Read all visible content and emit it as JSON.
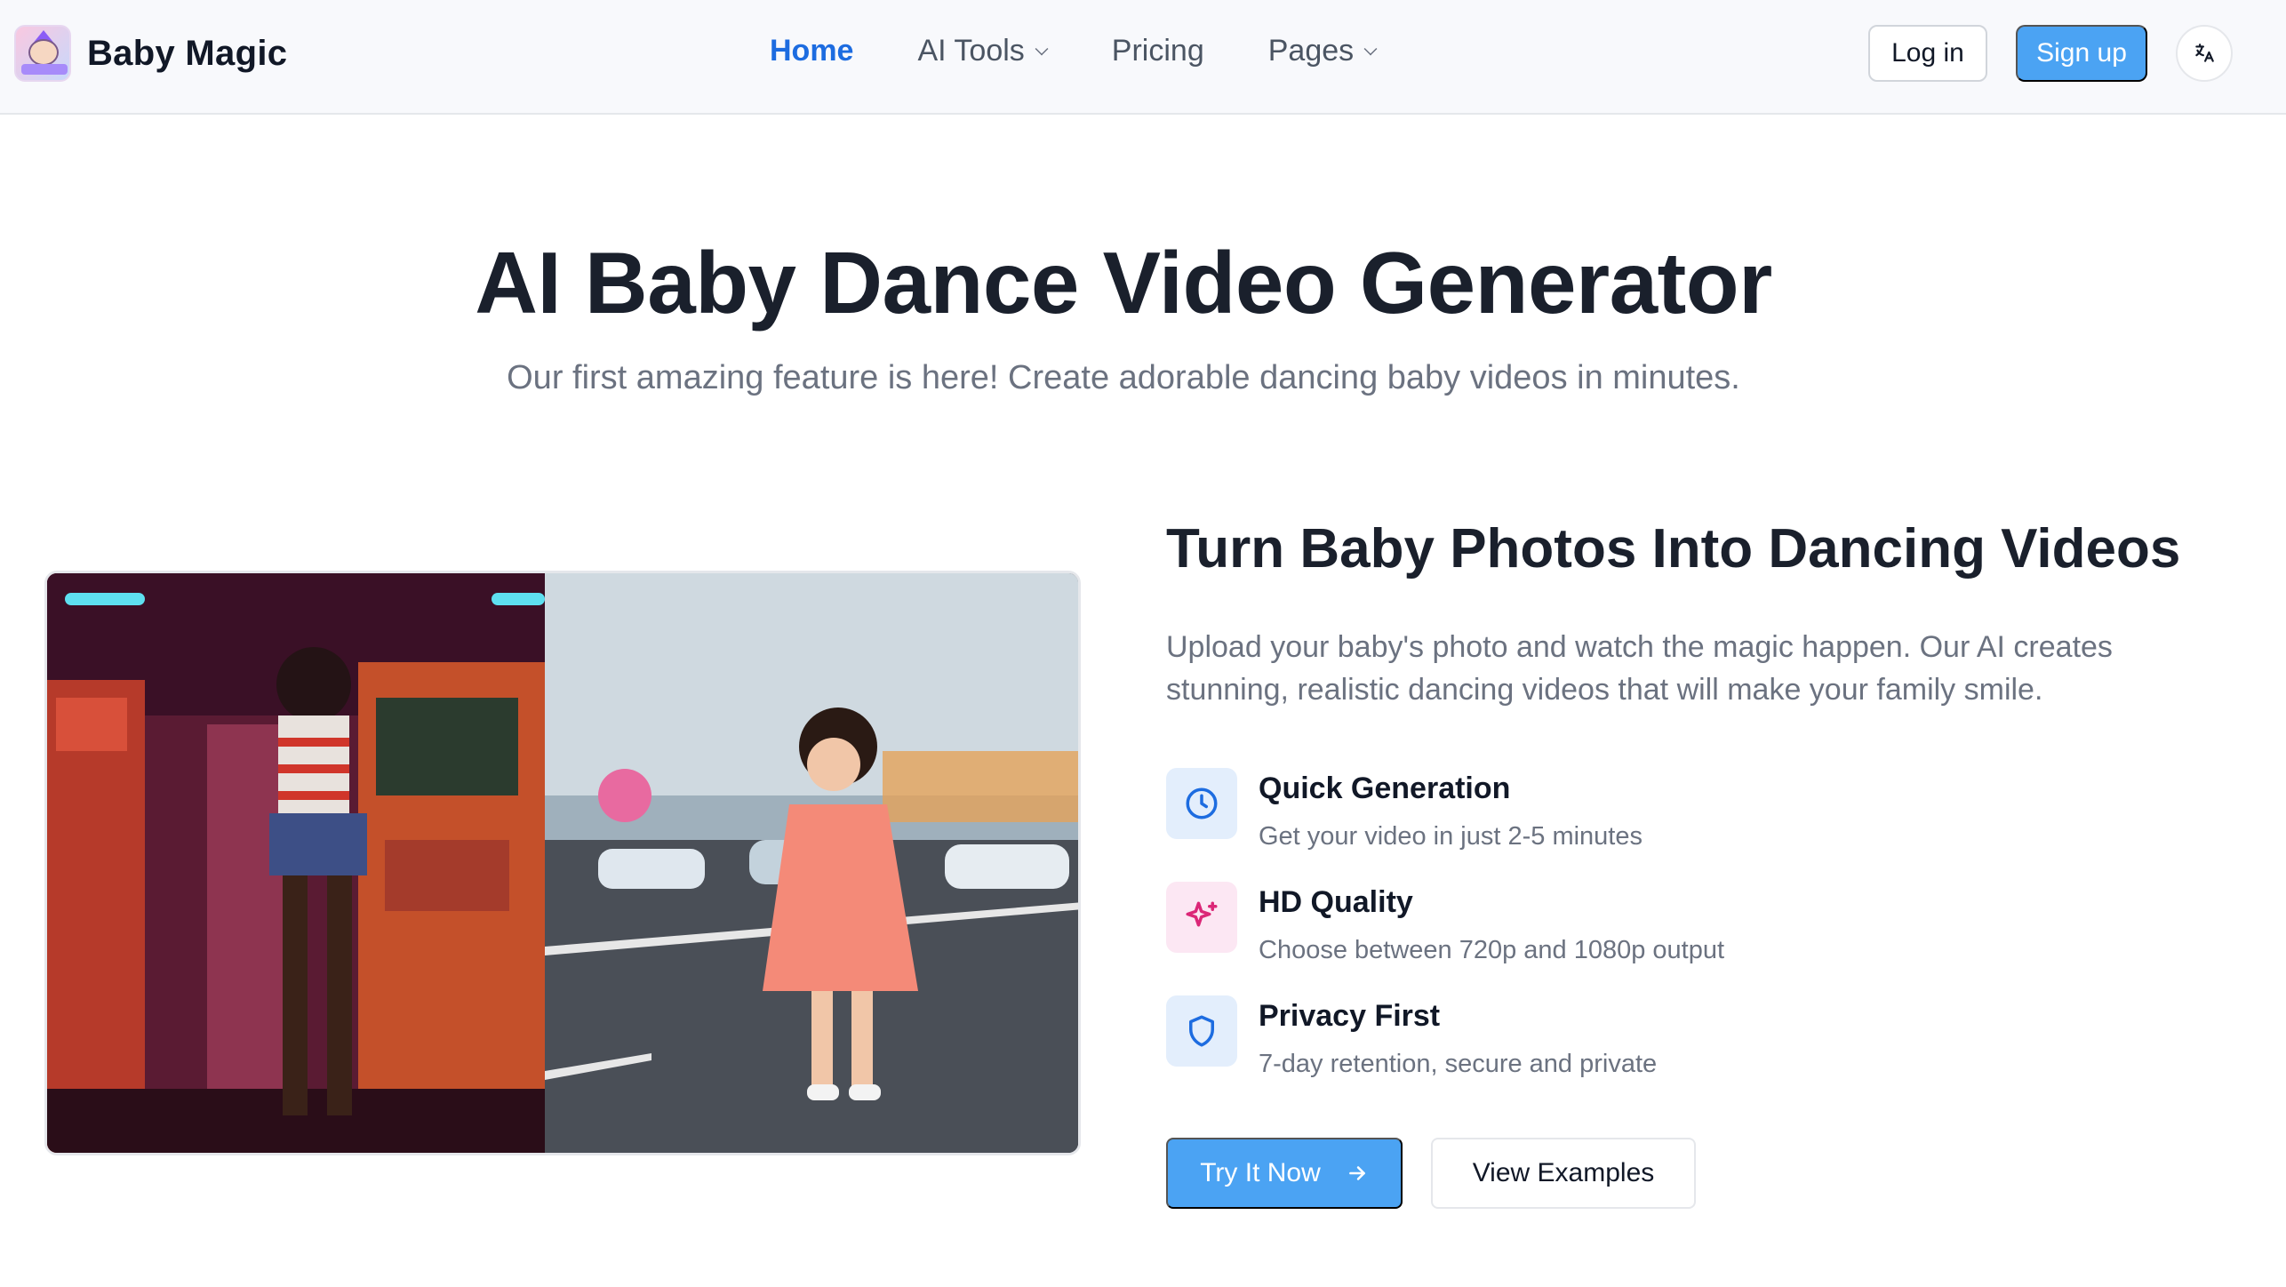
{
  "brand": {
    "name": "Baby Magic",
    "logo_icon": "baby-magic-logo"
  },
  "nav": {
    "items": [
      {
        "label": "Home",
        "active": true,
        "dropdown": false
      },
      {
        "label": "AI Tools",
        "active": false,
        "dropdown": true
      },
      {
        "label": "Pricing",
        "active": false,
        "dropdown": false
      },
      {
        "label": "Pages",
        "active": false,
        "dropdown": true
      }
    ],
    "login_label": "Log in",
    "signup_label": "Sign up",
    "language_icon": "translate-icon"
  },
  "hero": {
    "title": "AI Baby Dance Video Generator",
    "subtitle": "Our first amazing feature is here! Create adorable dancing baby videos in minutes."
  },
  "features": {
    "title": "Turn Baby Photos Into Dancing Videos",
    "description": "Upload your baby's photo and watch the magic happen. Our AI creates stunning, realistic dancing videos that will make your family smile.",
    "items": [
      {
        "title": "Quick Generation",
        "desc": "Get your video in just 2-5 minutes",
        "icon": "clock-icon",
        "icon_color": "#1d6ce0",
        "icon_bg": "#e3eefc"
      },
      {
        "title": "HD Quality",
        "desc": "Choose between 720p and 1080p output",
        "icon": "sparkles-icon",
        "icon_color": "#db2777",
        "icon_bg": "#fce7f3"
      },
      {
        "title": "Privacy First",
        "desc": "7-day retention, secure and private",
        "icon": "shield-icon",
        "icon_color": "#1d6ce0",
        "icon_bg": "#e3eefc"
      }
    ],
    "primary_button": "Try It Now",
    "secondary_button": "View Examples"
  },
  "colors": {
    "accent": "#4ba3f3",
    "active_link": "#1d6ce0",
    "heading": "#1a202c",
    "muted": "#6b7280"
  }
}
